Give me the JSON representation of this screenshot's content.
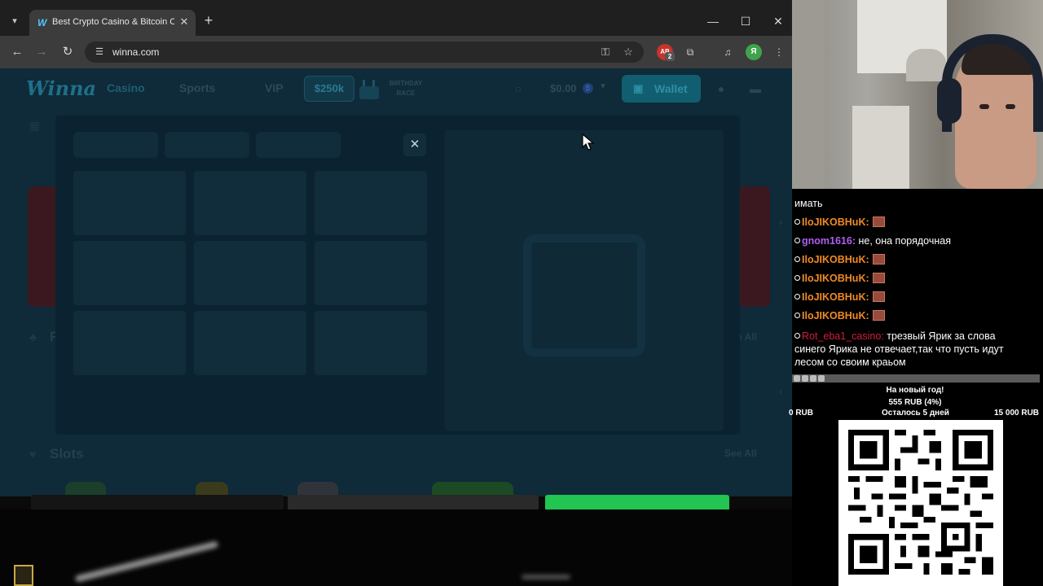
{
  "browser": {
    "tab_title": "Best Crypto Casino & Bitcoin C",
    "url": "winna.com",
    "extension_badge": "2",
    "profile_initial": "Я"
  },
  "site": {
    "logo": "Winna",
    "nav": [
      "Casino",
      "Sports",
      "VIP"
    ],
    "promo_amount": "$250k",
    "promo_text_line1": "BIRTHDAY",
    "promo_text_line2": "RACE",
    "balance": "$0.00",
    "wallet_label": "Wallet",
    "sections": {
      "slots_title": "Slots",
      "see_all": "See All",
      "see_all_partial": "e All",
      "section_partial": "P"
    }
  },
  "modal": {
    "close_glyph": "✕",
    "skeleton_tabs": 3,
    "skeleton_cells": 9,
    "state": "loading"
  },
  "chat": {
    "messages": [
      {
        "user": "",
        "text": "имать",
        "user_color": "#ffffff"
      },
      {
        "user": "IloJIKOBHuK:",
        "text": "",
        "emote": true,
        "user_color": "#f08a24"
      },
      {
        "user": "gnom1616:",
        "text": " не, она порядочная",
        "user_color": "#b05ef0"
      },
      {
        "user": "IloJIKOBHuK:",
        "text": "",
        "emote": true,
        "user_color": "#f08a24"
      },
      {
        "user": "IloJIKOBHuK:",
        "text": "",
        "emote": true,
        "user_color": "#f08a24"
      },
      {
        "user": "IloJIKOBHuK:",
        "text": "",
        "emote": true,
        "user_color": "#f08a24"
      },
      {
        "user": "IloJIKOBHuK:",
        "text": "",
        "emote": true,
        "user_color": "#f08a24"
      }
    ],
    "last_message": {
      "user": "Rot_eba1_casino:",
      "line1": " трезвый Ярик за слова",
      "line2": "синего Ярика не отвечает,так что пусть идут",
      "line3": "лесом со своим краьом",
      "user_color": "#d41c3c"
    }
  },
  "donation_goal": {
    "title": "На новый год!",
    "amount": "555 RUB (4%)",
    "progress_fraction": 0.037,
    "min": "0 RUB",
    "remaining": "Осталось 5 дней",
    "max": "15 000 RUB"
  },
  "colors": {
    "accent": "#115e70",
    "modal_bg": "#0b2330",
    "skeleton": "#112c3a",
    "chat_user_orange": "#f08a24",
    "chat_user_purple": "#b05ef0",
    "chat_user_red": "#d41c3c"
  },
  "icons": {
    "tab_menu": "chevron-down-icon",
    "close_tab": "close-icon",
    "new_tab": "plus-icon",
    "back": "arrow-left-icon",
    "forward": "arrow-right-icon",
    "reload": "reload-icon",
    "site_info": "tune-icon",
    "password": "key-icon",
    "bookmark": "star-icon",
    "extensions": "puzzle-icon",
    "media": "media-control-icon",
    "menu": "kebab-menu-icon",
    "search": "search-icon",
    "user": "user-icon",
    "chat": "chat-icon",
    "wallet": "wallet-icon",
    "slots": "heart-icon",
    "cursor": "mouse-pointer-icon"
  }
}
